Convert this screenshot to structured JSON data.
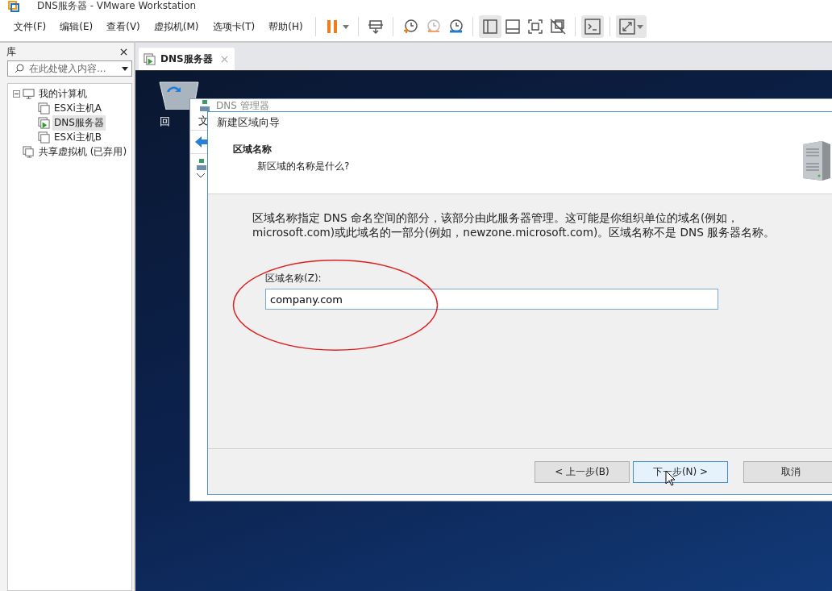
{
  "window": {
    "title": "DNS服务器 - VMware Workstation"
  },
  "menu": [
    "文件(F)",
    "编辑(E)",
    "查看(V)",
    "虚拟机(M)",
    "选项卡(T)",
    "帮助(H)"
  ],
  "toolbar": [
    {
      "items": [
        {
          "kind": "pause",
          "selected": false,
          "dropdown": true
        }
      ]
    },
    {
      "items": [
        {
          "kind": "send-keys",
          "selected": false,
          "dropdown": false
        }
      ]
    },
    {
      "items": [
        {
          "kind": "snapshot-take",
          "selected": false,
          "dropdown": false
        },
        {
          "kind": "snapshot-revert",
          "selected": false,
          "dropdown": false
        },
        {
          "kind": "snapshot-manager",
          "selected": false,
          "dropdown": false
        }
      ]
    },
    {
      "items": [
        {
          "kind": "view-library",
          "selected": true,
          "dropdown": false
        },
        {
          "kind": "view-thumbnail",
          "selected": false,
          "dropdown": false
        },
        {
          "kind": "view-fullscreen",
          "selected": false,
          "dropdown": false
        },
        {
          "kind": "view-unity",
          "selected": false,
          "dropdown": false
        }
      ]
    },
    {
      "items": [
        {
          "kind": "console",
          "selected": true,
          "dropdown": false
        }
      ]
    },
    {
      "items": [
        {
          "kind": "stretch",
          "selected": true,
          "dropdown": true
        }
      ]
    }
  ],
  "library": {
    "title": "库",
    "search": {
      "placeholder": "在此处键入内容..."
    },
    "tree": [
      {
        "kind": "computer",
        "label": "我的计算机",
        "expanded": true,
        "selected": false,
        "children": [
          {
            "kind": "vm",
            "label": "ESXi主机A",
            "selected": false,
            "running": false
          },
          {
            "kind": "vm",
            "label": "DNS服务器",
            "selected": true,
            "running": true
          },
          {
            "kind": "vm",
            "label": "ESXi主机B",
            "selected": false,
            "running": false
          }
        ]
      },
      {
        "kind": "shared",
        "label": "共享虚拟机 (已弃用)",
        "selected": false
      }
    ]
  },
  "tabs": [
    {
      "label": "DNS服务器",
      "selected": true,
      "running": true
    }
  ],
  "desktop": {
    "icons": [
      {
        "label": "回"
      }
    ]
  },
  "dns_manager": {
    "title": "DNS 管理器",
    "menu": [
      "文"
    ]
  },
  "wizard": {
    "title": "新建区域向导",
    "heading": "区域名称",
    "subheading": "新区域的名称是什么?",
    "description": "区域名称指定 DNS 命名空间的部分，该部分由此服务器管理。这可能是你组织单位的域名(例如，microsoft.com)或此域名的一部分(例如，newzone.microsoft.com)。区域名称不是 DNS 服务器名称。",
    "field": {
      "label": "区域名称(Z):",
      "value": "company.com"
    },
    "buttons": [
      {
        "label": "< 上一步(B)",
        "focused": false
      },
      {
        "label": "下一步(N) >",
        "focused": true
      },
      {
        "label": "取消",
        "focused": false
      }
    ]
  }
}
